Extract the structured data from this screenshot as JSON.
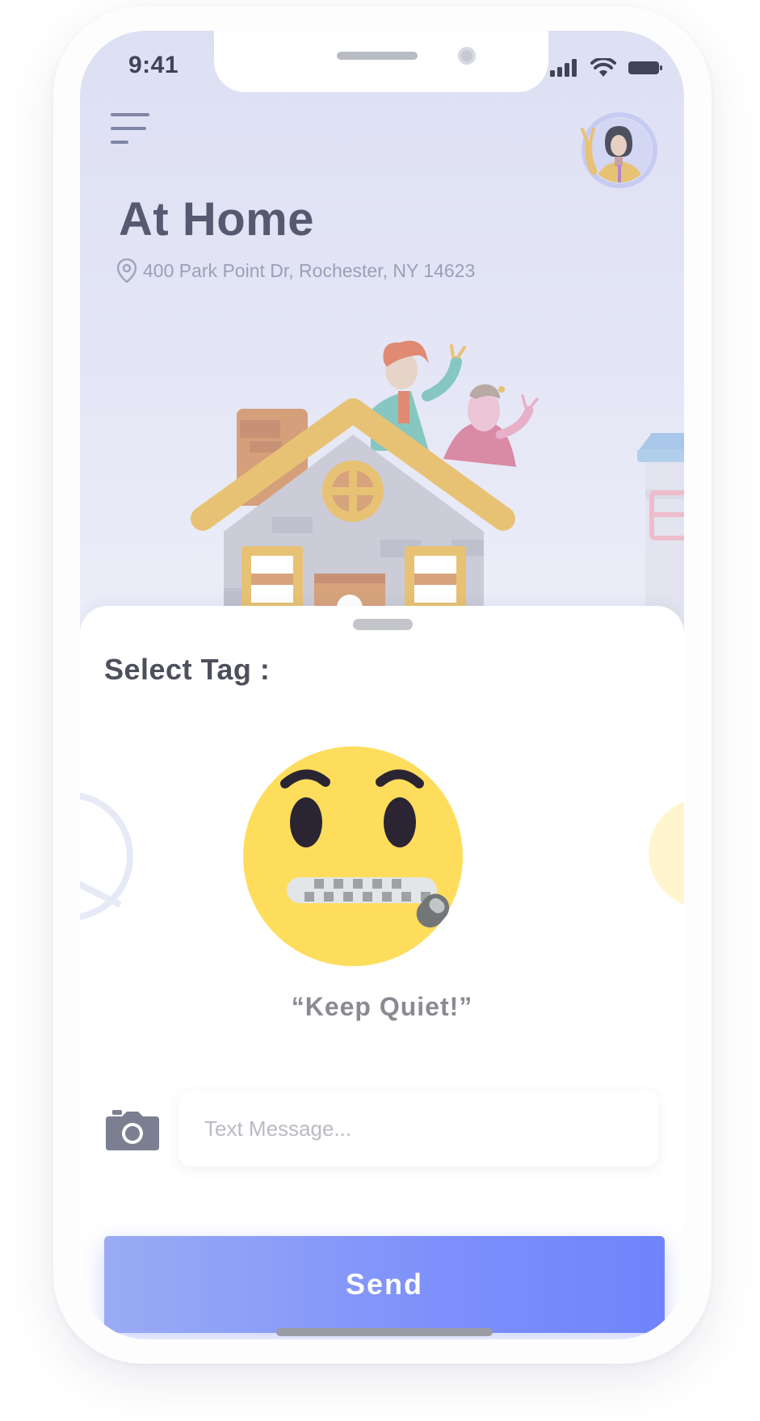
{
  "status_bar": {
    "time": "9:41",
    "icons": [
      "cellular-signal-icon",
      "wifi-icon",
      "battery-icon"
    ]
  },
  "header": {
    "menu_icon": "hamburger-menu-icon",
    "title": "At Home",
    "address": "400 Park Point Dr, Rochester, NY 14623",
    "location_icon": "location-pin-icon",
    "avatar": "user-avatar"
  },
  "sheet": {
    "heading": "Select Tag :",
    "selected_tag": {
      "icon": "zipper-mouth-face-icon",
      "label": "“Keep Quiet!”"
    },
    "message": {
      "camera_icon": "camera-icon",
      "placeholder": "Text Message...",
      "value": ""
    },
    "send_label": "Send"
  },
  "colors": {
    "accent": "#7d90fb",
    "hero_bg": "#dde0f3",
    "emoji": "#fedd5c",
    "title_text": "#565a70"
  }
}
